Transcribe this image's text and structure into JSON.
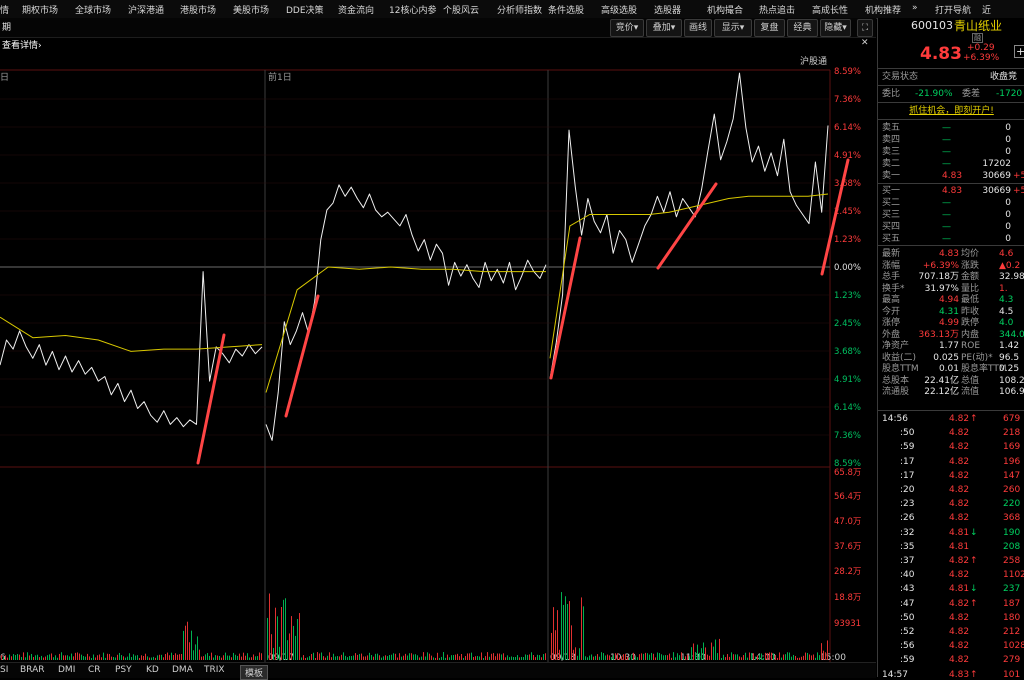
{
  "top_menu": {
    "items": [
      "情",
      "期权市场",
      "全球市场",
      "沪深港通",
      "港股市场",
      "美股市场",
      "DDE决策",
      "资金流向",
      "12核心内参",
      "个股风云",
      "分析师指数",
      "条件选股",
      "高级选股",
      "选股器",
      "机构撮合",
      "热点追击",
      "高成长性",
      "机构推荐",
      "»",
      "打开导航",
      "近"
    ]
  },
  "toolbar": {
    "left_link": "查看详情›",
    "left_tab": "期",
    "buttons": [
      "竞价▾",
      "叠加▾",
      "画线",
      "显示▾",
      "复盘",
      "经典",
      "隐藏▾"
    ],
    "icon_expand": "expand-icon",
    "icon_close": "close-icon"
  },
  "stock": {
    "code": "600103",
    "name": "青山纸业",
    "tag": "融",
    "price": "4.83",
    "change": "+0.29",
    "change_pct": "+6.39%",
    "add_symbol": "+"
  },
  "panel": {
    "status_label": "交易状态",
    "status_value": "收盘竞",
    "weibi_label": "委比",
    "weibi_value": "-21.90%",
    "weicha_label": "委差",
    "weicha_value": "-1720",
    "promo": "抓住机会，即刻开户!",
    "asks": [
      {
        "label": "卖五",
        "price": "—",
        "vol": "0",
        "chg": ""
      },
      {
        "label": "卖四",
        "price": "—",
        "vol": "0",
        "chg": ""
      },
      {
        "label": "卖三",
        "price": "—",
        "vol": "0",
        "chg": ""
      },
      {
        "label": "卖二",
        "price": "—",
        "vol": "17202",
        "chg": ""
      },
      {
        "label": "卖一",
        "price": "4.83",
        "vol": "30669",
        "chg": "+5"
      }
    ],
    "bids": [
      {
        "label": "买一",
        "price": "4.83",
        "vol": "30669",
        "chg": "+5"
      },
      {
        "label": "买二",
        "price": "—",
        "vol": "0",
        "chg": ""
      },
      {
        "label": "买三",
        "price": "—",
        "vol": "0",
        "chg": ""
      },
      {
        "label": "买四",
        "price": "—",
        "vol": "0",
        "chg": ""
      },
      {
        "label": "买五",
        "price": "—",
        "vol": "0",
        "chg": ""
      }
    ],
    "stats": [
      {
        "l1": "最新",
        "v1": "4.83",
        "c1": "red",
        "l2": "均价",
        "v2": "4.6",
        "c2": "red"
      },
      {
        "l1": "涨幅",
        "v1": "+6.39%",
        "c1": "red",
        "l2": "涨跌",
        "v2": "▲0.2",
        "c2": "red"
      },
      {
        "l1": "总手",
        "v1": "707.18万",
        "c1": "wht",
        "l2": "金额",
        "v2": "32.98",
        "c2": "wht"
      },
      {
        "l1": "换手*",
        "v1": "31.97%",
        "c1": "wht",
        "l2": "量比",
        "v2": "1.",
        "c2": "red"
      },
      {
        "l1": "最高",
        "v1": "4.94",
        "c1": "red",
        "l2": "最低",
        "v2": "4.3",
        "c2": "grn"
      },
      {
        "l1": "今开",
        "v1": "4.31",
        "c1": "grn",
        "l2": "昨收",
        "v2": "4.5",
        "c2": "wht"
      },
      {
        "l1": "涨停",
        "v1": "4.99",
        "c1": "red",
        "l2": "跌停",
        "v2": "4.0",
        "c2": "grn"
      },
      {
        "l1": "外盘",
        "v1": "363.13万",
        "c1": "red",
        "l2": "内盘",
        "v2": "344.06",
        "c2": "grn"
      },
      {
        "l1": "净资产",
        "v1": "1.77",
        "c1": "wht",
        "l2": "ROE",
        "v2": "1.42",
        "c2": "wht"
      },
      {
        "l1": "收益(二)",
        "v1": "0.025",
        "c1": "wht",
        "l2": "PE(动)*",
        "v2": "96.5",
        "c2": "wht"
      },
      {
        "l1": "股息TTM",
        "v1": "0.01",
        "c1": "wht",
        "l2": "股息率TTM",
        "v2": "0.25",
        "c2": "wht"
      },
      {
        "l1": "总股本",
        "v1": "22.41亿",
        "c1": "wht",
        "l2": "总值",
        "v2": "108.2",
        "c2": "wht"
      },
      {
        "l1": "流通股",
        "v1": "22.12亿",
        "c1": "wht",
        "l2": "流值",
        "v2": "106.9",
        "c2": "wht"
      }
    ],
    "ticks": [
      {
        "t": "14:56",
        "p": "4.82",
        "a": "↑",
        "ac": "red",
        "v": "679",
        "vc": "red"
      },
      {
        "t": ":50",
        "p": "4.82",
        "a": "",
        "ac": "",
        "v": "218",
        "vc": "red"
      },
      {
        "t": ":59",
        "p": "4.82",
        "a": "",
        "ac": "",
        "v": "169",
        "vc": "red"
      },
      {
        "t": ":17",
        "p": "4.82",
        "a": "",
        "ac": "",
        "v": "196",
        "vc": "red"
      },
      {
        "t": ":17",
        "p": "4.82",
        "a": "",
        "ac": "",
        "v": "147",
        "vc": "red"
      },
      {
        "t": ":20",
        "p": "4.82",
        "a": "",
        "ac": "",
        "v": "260",
        "vc": "red"
      },
      {
        "t": ":23",
        "p": "4.82",
        "a": "",
        "ac": "",
        "v": "220",
        "vc": "grn"
      },
      {
        "t": ":26",
        "p": "4.82",
        "a": "",
        "ac": "",
        "v": "368",
        "vc": "red"
      },
      {
        "t": ":32",
        "p": "4.81",
        "a": "↓",
        "ac": "grn",
        "v": "190",
        "vc": "grn"
      },
      {
        "t": ":35",
        "p": "4.81",
        "a": "",
        "ac": "",
        "v": "208",
        "vc": "grn"
      },
      {
        "t": ":37",
        "p": "4.82",
        "a": "↑",
        "ac": "red",
        "v": "258",
        "vc": "red"
      },
      {
        "t": ":40",
        "p": "4.82",
        "a": "",
        "ac": "",
        "v": "1102",
        "vc": "red"
      },
      {
        "t": ":43",
        "p": "4.81",
        "a": "↓",
        "ac": "grn",
        "v": "237",
        "vc": "grn"
      },
      {
        "t": ":47",
        "p": "4.82",
        "a": "↑",
        "ac": "red",
        "v": "187",
        "vc": "red"
      },
      {
        "t": ":50",
        "p": "4.82",
        "a": "",
        "ac": "",
        "v": "180",
        "vc": "red"
      },
      {
        "t": ":52",
        "p": "4.82",
        "a": "",
        "ac": "",
        "v": "212",
        "vc": "red"
      },
      {
        "t": ":56",
        "p": "4.82",
        "a": "",
        "ac": "",
        "v": "1028",
        "vc": "red"
      },
      {
        "t": ":59",
        "p": "4.82",
        "a": "",
        "ac": "",
        "v": "279",
        "vc": "red"
      },
      {
        "t": "14:57",
        "p": "4.83",
        "a": "↑",
        "ac": "red",
        "v": "101",
        "vc": "red"
      }
    ]
  },
  "chart_data": {
    "type": "line",
    "title": "",
    "right_top_label": "沪股通",
    "day_label_left": "日",
    "day_label_mid": "前1日",
    "pct_ticks_up": [
      "8.59%",
      "7.36%",
      "6.14%",
      "4.91%",
      "3.68%",
      "2.45%",
      "1.23%"
    ],
    "pct_zero": "0.00%",
    "pct_ticks_down": [
      "1.23%",
      "2.45%",
      "3.68%",
      "4.91%",
      "6.14%",
      "7.36%",
      "8.59%"
    ],
    "vol_ticks": [
      "65.8万",
      "56.4万",
      "47.0万",
      "37.6万",
      "28.2万",
      "18.8万",
      "93931"
    ],
    "x_ticks": [
      "6",
      "09/17",
      "09/18",
      "10:30",
      "11:30",
      "14:00",
      "15:00"
    ],
    "ylim_pct": [
      -8.59,
      8.59
    ],
    "grid": true,
    "series": [
      {
        "values": [
          -4.3,
          -3.2,
          -3.6,
          -2.8,
          -3.5,
          -4.0,
          -3.4,
          -4.3,
          -3.7,
          -4.5,
          -3.9,
          -4.6,
          -4.1,
          -4.7,
          -4.4,
          -5.0,
          -4.8,
          -5.6,
          -5.1,
          -5.9,
          -5.4,
          -6.2,
          -5.9,
          -6.5,
          -6.8,
          -6.3,
          -6.9,
          -6.6,
          -7.0,
          -6.7,
          -6.9,
          -0.2,
          -5.0,
          -3.5,
          -3.8,
          -4.2,
          -3.6,
          -3.9,
          -3.4,
          -3.8,
          -3.5
        ]
      },
      {
        "values": [
          -6.9,
          -7.6,
          -5.5,
          -2.4,
          -3.4,
          -2.8,
          -2.0,
          -2.9,
          -1.5,
          1.2,
          2.5,
          2.8,
          3.6,
          3.1,
          3.5,
          3.0,
          2.6,
          3.2,
          2.5,
          2.2,
          2.4,
          2.1,
          1.8,
          2.3,
          1.4,
          0.7,
          1.2,
          0.3,
          1.0,
          0.6,
          -0.8,
          0.2,
          -0.4,
          0.1,
          -0.5,
          -0.9,
          0.2,
          -0.6,
          -0.1,
          -0.7,
          0.2,
          -1.0,
          -0.4,
          0.3,
          -0.2,
          -0.5,
          0.1
        ]
      },
      {
        "values": [
          -4.9,
          -3.3,
          -1.2,
          6.0,
          3.5,
          1.4,
          3.0,
          2.0,
          1.5,
          2.3,
          0.6,
          1.6,
          1.2,
          0.2,
          1.0,
          1.8,
          2.3,
          3.1,
          2.4,
          3.3,
          2.2,
          3.0,
          2.6,
          2.2,
          3.4,
          5.1,
          6.7,
          4.7,
          5.5,
          6.5,
          8.5,
          6.1,
          4.6,
          5.3,
          4.2,
          5.0,
          4.0,
          5.6,
          3.3,
          2.7,
          2.3,
          1.9,
          4.6,
          2.4,
          6.2
        ]
      },
      {
        "values": [
          -2.2,
          -3.1,
          -3.0,
          -3.2,
          -3.7,
          -3.6,
          -3.6,
          -3.5,
          -3.4
        ]
      },
      {
        "values": [
          -5.5,
          -1.0,
          0.0,
          -0.1,
          0.0,
          -0.1,
          -0.1,
          -0.2,
          -0.2,
          -0.2
        ]
      },
      {
        "values": [
          -4.0,
          1.8,
          2.3,
          2.3,
          2.3,
          2.3,
          2.4,
          2.6,
          2.8,
          3.0,
          3.1,
          3.1,
          3.1,
          3.1,
          3.2
        ]
      }
    ]
  }
}
